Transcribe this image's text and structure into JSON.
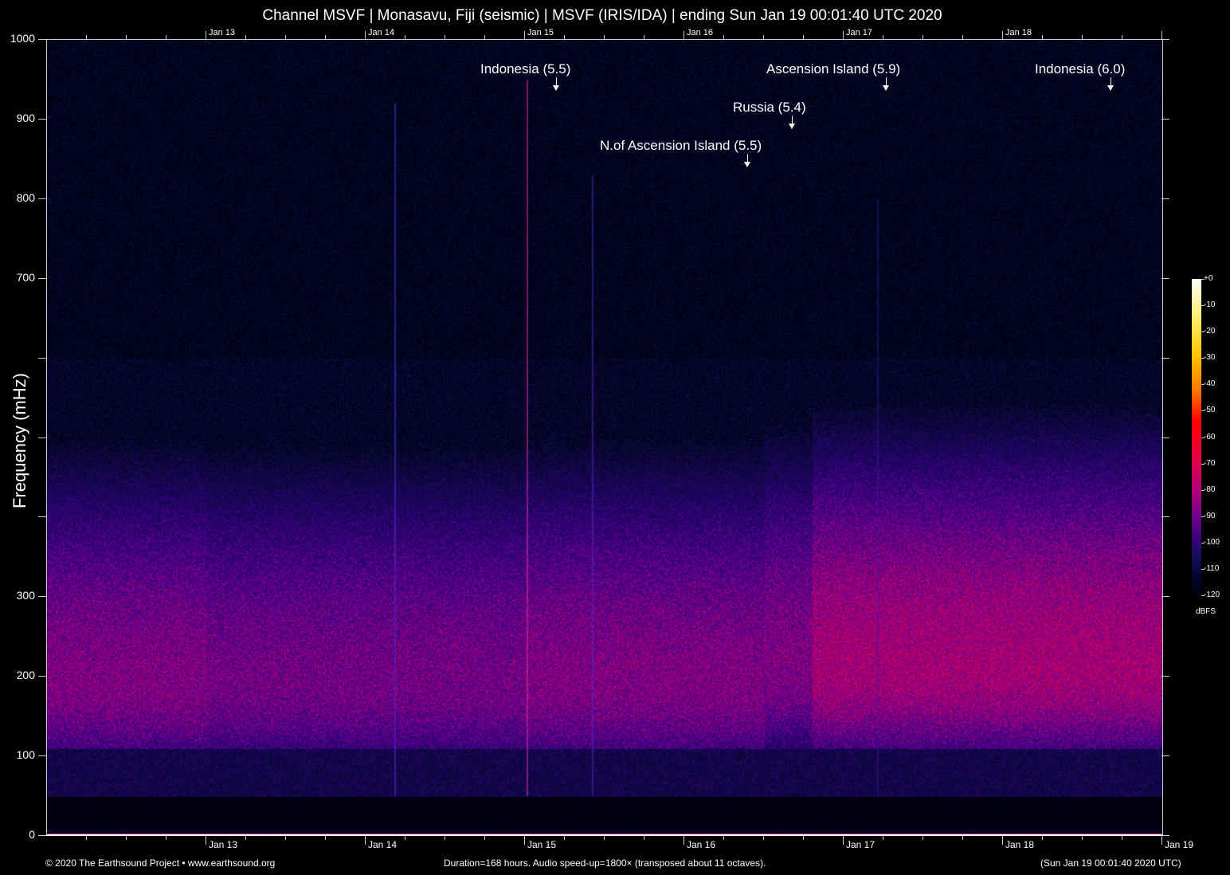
{
  "title": "Channel MSVF | Monasavu, Fiji (seismic) | MSVF (IRIS/IDA) | ending Sun Jan 19 00:01:40 UTC 2020",
  "footer": {
    "left": "© 2020 The Earthsound Project • www.earthsound.org",
    "center": "Duration=168 hours. Audio speed-up=1800× (transposed about 11 octaves).",
    "right": "(Sun Jan 19 00:01:40 2020 UTC)"
  },
  "chart_data": {
    "type": "heatmap",
    "title": "Channel MSVF | Monasavu, Fiji (seismic) | MSVF (IRIS/IDA) | ending Sun Jan 19 00:01:40 UTC 2020",
    "xlabel": "",
    "ylabel": "Frequency (mHz)",
    "x_range_days": [
      0,
      7
    ],
    "x_ticks": [
      "Jan 13",
      "Jan 14",
      "Jan 15",
      "Jan 16",
      "Jan 17",
      "Jan 18",
      "Jan 19"
    ],
    "x_tick_days": [
      1,
      2,
      3,
      4,
      5,
      6,
      7
    ],
    "ylim": [
      0,
      1000
    ],
    "y_ticks": [
      "0",
      "100",
      "200",
      "300",
      "",
      "",
      "",
      "700",
      "800",
      "900",
      "1000"
    ],
    "y_tick_values": [
      0,
      100,
      200,
      300,
      400,
      500,
      600,
      700,
      800,
      900,
      1000
    ],
    "colorbar": {
      "label": "dBFS",
      "ticks": [
        "+0",
        "-10",
        "-20",
        "-30",
        "-40",
        "-50",
        "-60",
        "-70",
        "-80",
        "-90",
        "-100",
        "-110",
        "-120"
      ],
      "range": [
        -120,
        0
      ]
    },
    "annotations": [
      {
        "text": "Indonesia (5.5)",
        "day": 3.2,
        "row": 0
      },
      {
        "text": "Ascension Island (5.9)",
        "day": 5.27,
        "row": 0
      },
      {
        "text": "Indonesia (6.0)",
        "day": 6.68,
        "row": 0
      },
      {
        "text": "Russia (5.4)",
        "day": 4.68,
        "row": 1
      },
      {
        "text": "N.of Ascension Island (5.5)",
        "day": 4.4,
        "row": 2
      }
    ]
  }
}
